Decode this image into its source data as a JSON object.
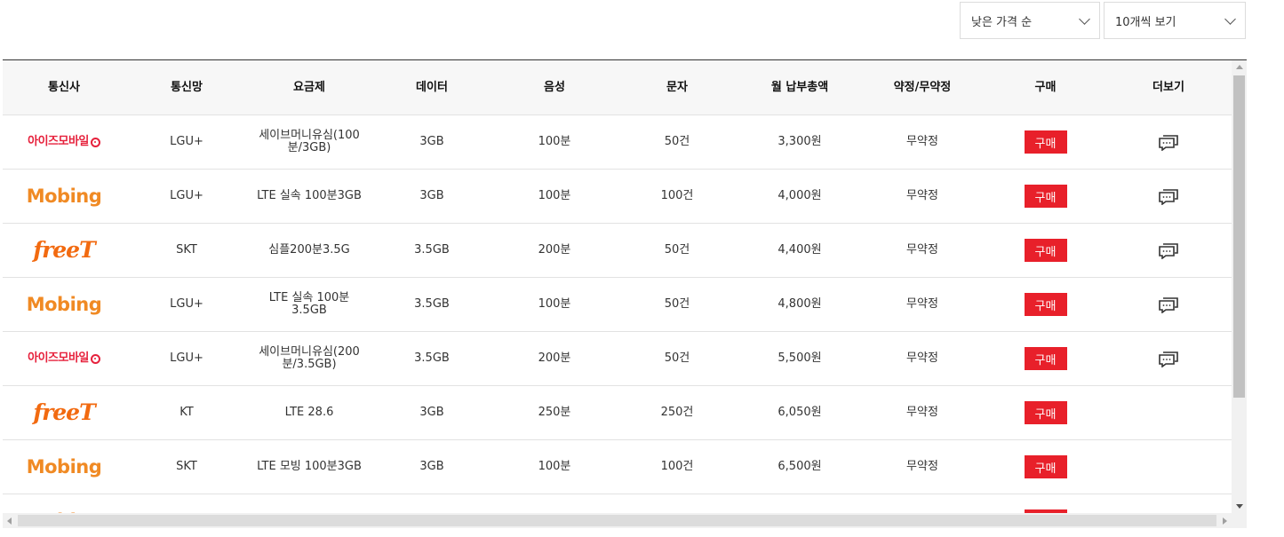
{
  "controls": {
    "sort_select": "낮은 가격 순",
    "per_page_select": "10개씩 보기"
  },
  "table": {
    "headers": [
      "통신사",
      "통신망",
      "요금제",
      "데이터",
      "음성",
      "문자",
      "월 납부총액",
      "약정/무약정",
      "구매",
      "더보기"
    ],
    "buy_label": "구매",
    "rows": [
      {
        "carrier": "아이즈모바일",
        "logo": "izs",
        "network": "LGU+",
        "plan": "세이브머니유심(100분/3GB)",
        "data": "3GB",
        "voice": "100분",
        "sms": "50건",
        "price": "3,300원",
        "contract": "무약정",
        "more": true
      },
      {
        "carrier": "Mobing",
        "logo": "mobing",
        "network": "LGU+",
        "plan": "LTE 실속 100분3GB",
        "data": "3GB",
        "voice": "100분",
        "sms": "100건",
        "price": "4,000원",
        "contract": "무약정",
        "more": true
      },
      {
        "carrier": "freeT",
        "logo": "freet",
        "network": "SKT",
        "plan": "심플200분3.5G",
        "data": "3.5GB",
        "voice": "200분",
        "sms": "50건",
        "price": "4,400원",
        "contract": "무약정",
        "more": true
      },
      {
        "carrier": "Mobing",
        "logo": "mobing",
        "network": "LGU+",
        "plan": "LTE 실속 100분3.5GB",
        "data": "3.5GB",
        "voice": "100분",
        "sms": "50건",
        "price": "4,800원",
        "contract": "무약정",
        "more": true
      },
      {
        "carrier": "아이즈모바일",
        "logo": "izs",
        "network": "LGU+",
        "plan": "세이브머니유심(200분/3.5GB)",
        "data": "3.5GB",
        "voice": "200분",
        "sms": "50건",
        "price": "5,500원",
        "contract": "무약정",
        "more": true
      },
      {
        "carrier": "freeT",
        "logo": "freet",
        "network": "KT",
        "plan": "LTE 28.6",
        "data": "3GB",
        "voice": "250분",
        "sms": "250건",
        "price": "6,050원",
        "contract": "무약정",
        "more": false
      },
      {
        "carrier": "Mobing",
        "logo": "mobing",
        "network": "SKT",
        "plan": "LTE 모빙 100분3GB",
        "data": "3GB",
        "voice": "100분",
        "sms": "100건",
        "price": "6,500원",
        "contract": "무약정",
        "more": false
      },
      {
        "carrier": "Mobing",
        "logo": "mobing",
        "network": "",
        "plan": "",
        "data": "",
        "voice": "",
        "sms": "",
        "price": "",
        "contract": "",
        "more": true
      }
    ]
  },
  "colors": {
    "buy_button": "#e8202a",
    "header_bg": "#f7f7f7"
  }
}
